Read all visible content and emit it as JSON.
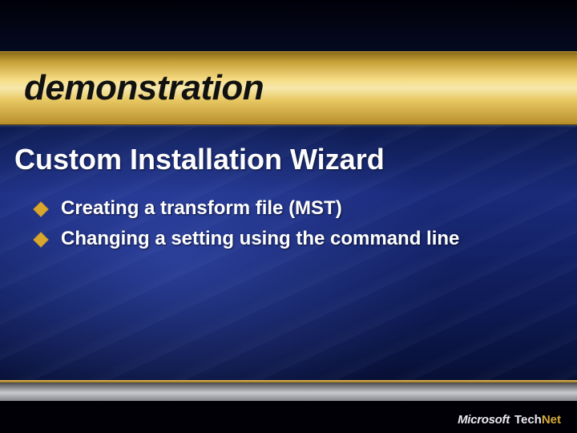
{
  "header": {
    "title": "demonstration"
  },
  "subtitle": "Custom Installation Wizard",
  "bullets": [
    "Creating a transform file (MST)",
    "Changing a setting using the command line"
  ],
  "brand": {
    "company": "Microsoft",
    "product_prefix": "Tech",
    "product_suffix": "Net"
  }
}
